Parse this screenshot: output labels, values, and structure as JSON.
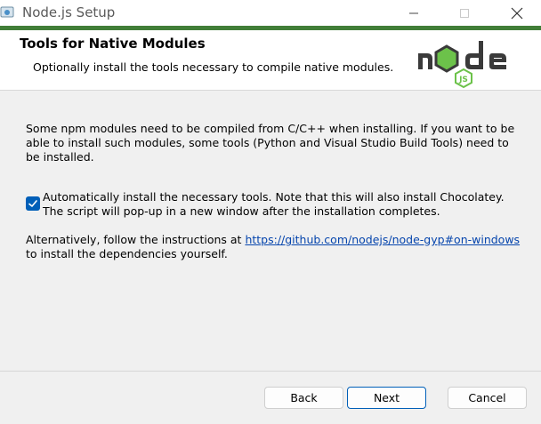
{
  "window": {
    "title": "Node.js Setup",
    "accent_color": "#417e38"
  },
  "header": {
    "title": "Tools for Native Modules",
    "subtitle": "Optionally install the tools necessary to compile native modules."
  },
  "content": {
    "description": "Some npm modules need to be compiled from C/C++ when installing. If you want to be able to install such modules, some tools (Python and Visual Studio Build Tools) need to be installed.",
    "checkbox": {
      "checked": true,
      "label": "Automatically install the necessary tools. Note that this will also install Chocolatey. The script will pop-up in a new window after the installation completes."
    },
    "alt_prefix": "Alternatively, follow the instructions at ",
    "alt_link": "https://github.com/nodejs/node-gyp#on-windows",
    "alt_suffix": " to install the dependencies yourself."
  },
  "buttons": {
    "back": "Back",
    "next": "Next",
    "cancel": "Cancel"
  },
  "icons": {
    "app": "installer-icon",
    "minimize": "minimize-icon",
    "maximize": "maximize-icon",
    "close": "close-icon",
    "logo": "nodejs-logo"
  }
}
